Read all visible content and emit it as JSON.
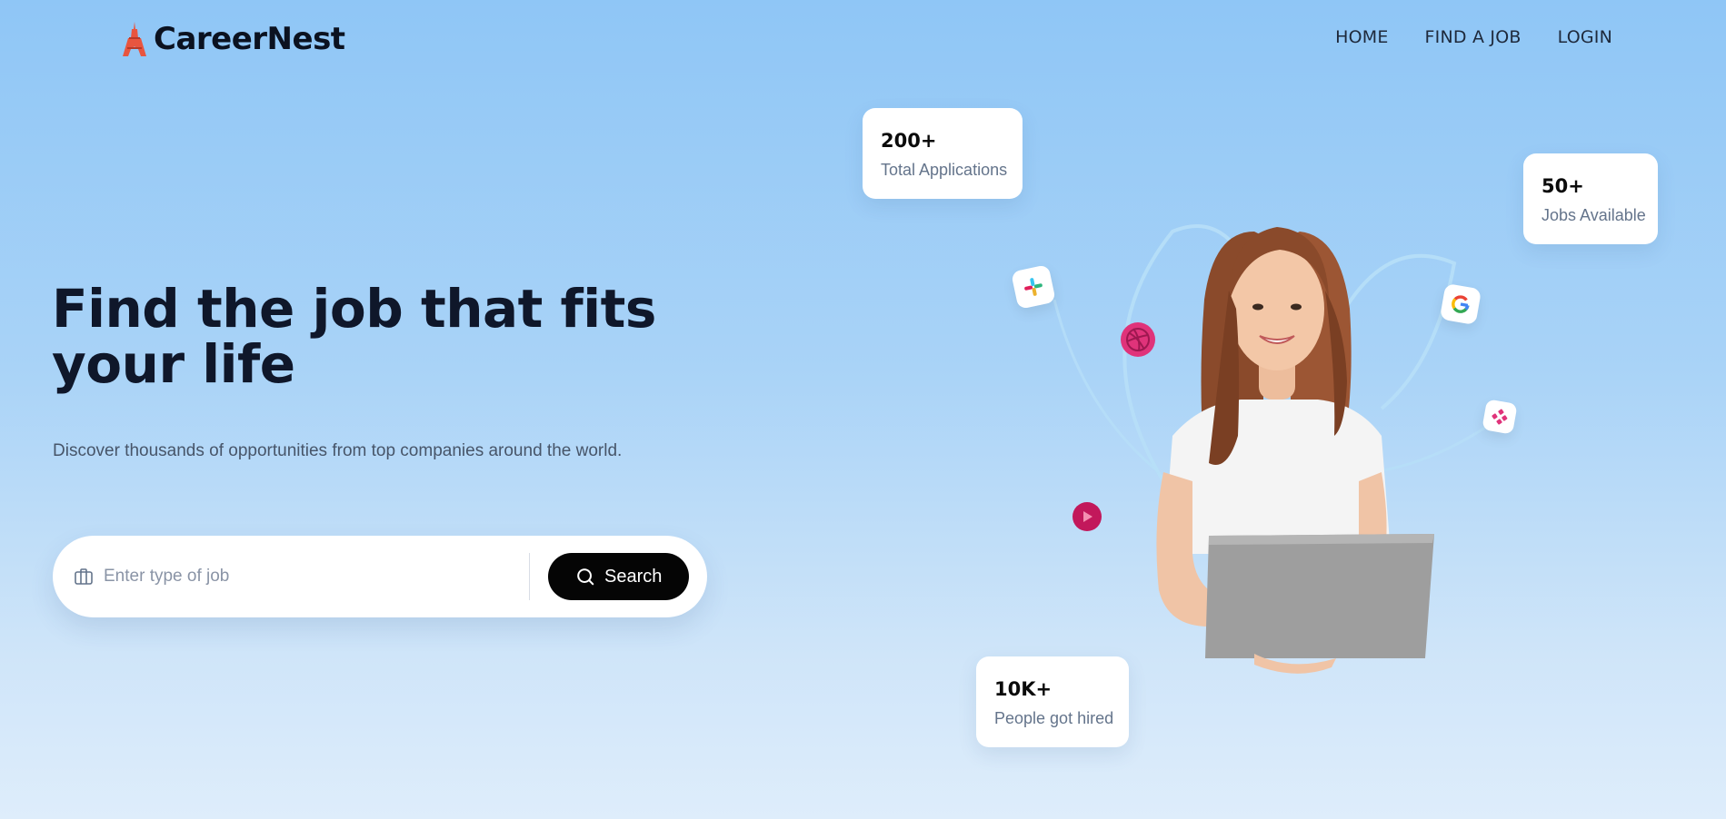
{
  "brand": {
    "name": "CareerNest",
    "logo_icon": "eiffel-tower-icon"
  },
  "nav": {
    "items": [
      {
        "label": "HOME"
      },
      {
        "label": "FIND A JOB"
      },
      {
        "label": "LOGIN"
      }
    ]
  },
  "hero": {
    "title": "Find the job that fits your life",
    "subtitle": "Discover thousands of opportunities from top companies around the world."
  },
  "search": {
    "placeholder": "Enter type of job",
    "value": "",
    "button_label": "Search",
    "input_icon": "briefcase-icon",
    "button_icon": "search-icon"
  },
  "stats": [
    {
      "value": "200+",
      "label": "Total Applications"
    },
    {
      "value": "50+",
      "label": "Jobs Available"
    },
    {
      "value": "10K+",
      "label": "People got hired"
    }
  ],
  "floating_icons": [
    "slack-icon",
    "dribbble-icon",
    "play-icon",
    "google-icon",
    "dots-app-icon"
  ],
  "colors": {
    "background_top": "#8fc6f6",
    "background_bottom": "#deedfb",
    "button": "#050505",
    "heading": "#0f172a",
    "accent_pink": "#e0337a"
  }
}
